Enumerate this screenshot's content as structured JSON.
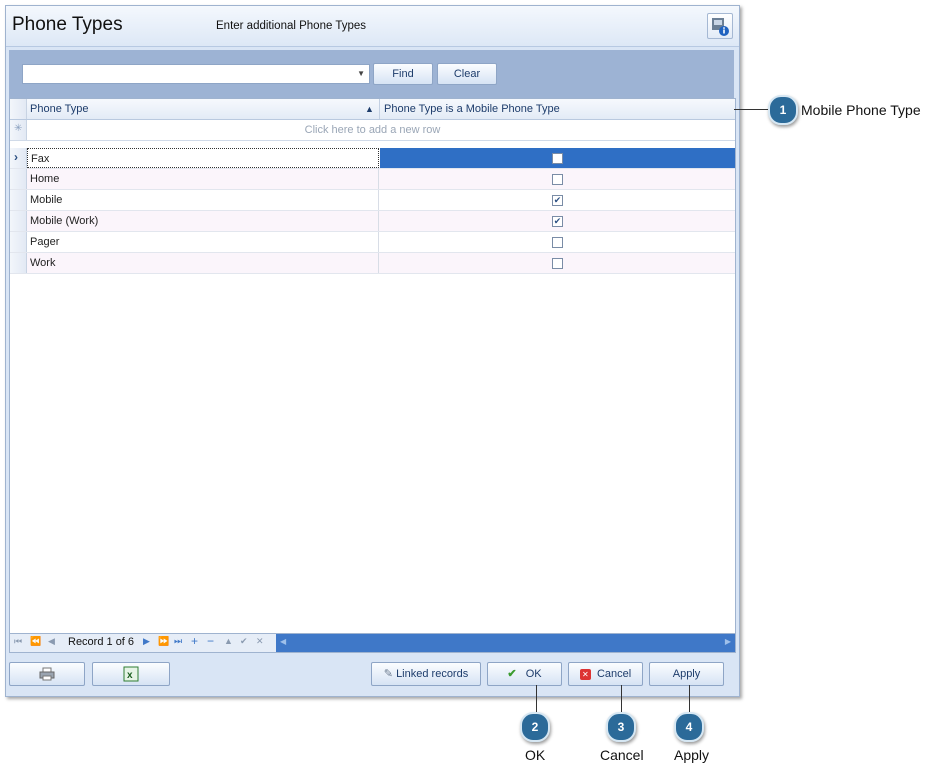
{
  "window": {
    "title": "Phone Types",
    "subtitle": "Enter additional Phone Types"
  },
  "toolbar": {
    "search_value": "",
    "find_label": "Find",
    "clear_label": "Clear"
  },
  "grid": {
    "columns": [
      "Phone Type",
      "Phone Type is a Mobile Phone Type"
    ],
    "sort_indicator": "▲",
    "new_row_text": "Click here to add a new row",
    "rows": [
      {
        "name": "Fax",
        "mobile": false,
        "selected": true
      },
      {
        "name": "Home",
        "mobile": false,
        "selected": false
      },
      {
        "name": "Mobile",
        "mobile": true,
        "selected": false
      },
      {
        "name": "Mobile (Work)",
        "mobile": true,
        "selected": false
      },
      {
        "name": "Pager",
        "mobile": false,
        "selected": false
      },
      {
        "name": "Work",
        "mobile": false,
        "selected": false
      }
    ]
  },
  "navigator": {
    "record_text": "Record 1 of 6"
  },
  "footer": {
    "linked_records_label": "Linked records",
    "ok_label": "OK",
    "cancel_label": "Cancel",
    "apply_label": "Apply"
  },
  "callouts": [
    {
      "number": "1",
      "label": "Mobile Phone Type"
    },
    {
      "number": "2",
      "label": "OK"
    },
    {
      "number": "3",
      "label": "Cancel"
    },
    {
      "number": "4",
      "label": "Apply"
    }
  ],
  "icons": [
    "info-icon",
    "dropdown-arrow-icon",
    "new-row-icon",
    "row-indicator-icon",
    "print-icon",
    "excel-icon",
    "pencil-icon",
    "checkmark-icon",
    "cancel-icon"
  ],
  "colors": {
    "selection": "#2f6fc5",
    "callout": "#2b6a99"
  }
}
